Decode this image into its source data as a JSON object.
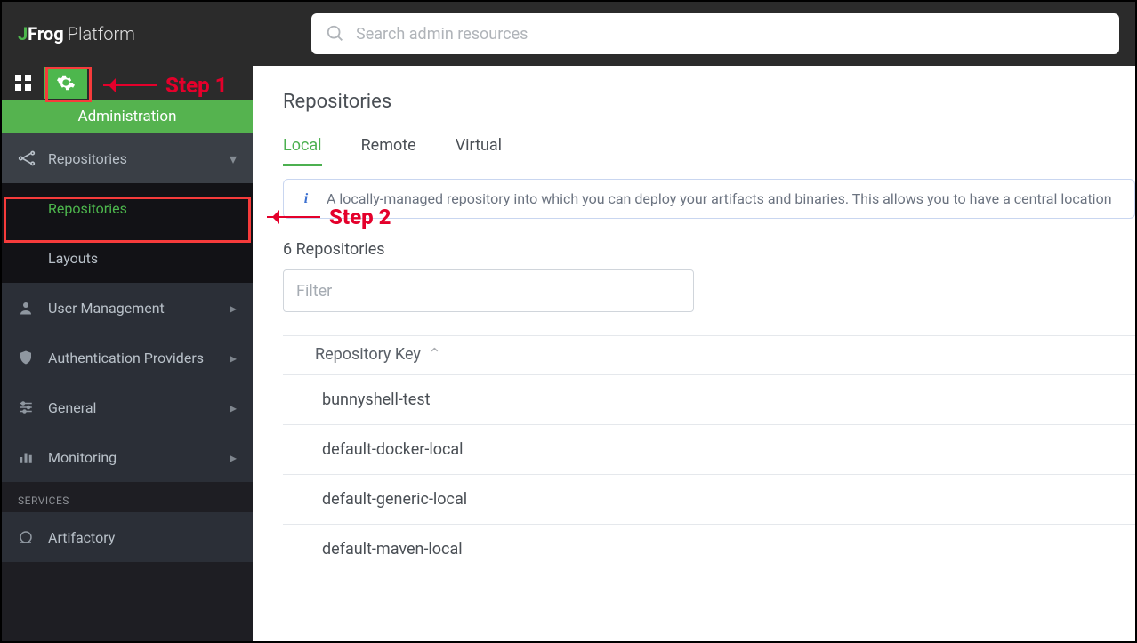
{
  "brand": {
    "j": "J",
    "frog": "Frog",
    "platform": "Platform"
  },
  "search": {
    "placeholder": "Search admin resources"
  },
  "sidebar": {
    "admin_label": "Administration",
    "items": [
      {
        "label": "Repositories",
        "icon": "distribute",
        "expanded": true,
        "children": [
          {
            "label": "Repositories",
            "active": true
          },
          {
            "label": "Layouts"
          }
        ]
      },
      {
        "label": "User Management",
        "icon": "user"
      },
      {
        "label": "Authentication Providers",
        "icon": "shield"
      },
      {
        "label": "General",
        "icon": "sliders"
      },
      {
        "label": "Monitoring",
        "icon": "bars"
      }
    ],
    "services_header": "SERVICES",
    "services": [
      {
        "label": "Artifactory",
        "icon": "circle"
      }
    ]
  },
  "main": {
    "title": "Repositories",
    "tabs": [
      {
        "label": "Local",
        "active": true
      },
      {
        "label": "Remote"
      },
      {
        "label": "Virtual"
      }
    ],
    "info": "A locally-managed repository into which you can deploy your artifacts and binaries. This allows you to have a central location",
    "count_label": "6 Repositories",
    "filter_placeholder": "Filter",
    "column_header": "Repository Key",
    "rows": [
      {
        "key": "bunnyshell-test"
      },
      {
        "key": "default-docker-local"
      },
      {
        "key": "default-generic-local"
      },
      {
        "key": "default-maven-local"
      }
    ]
  },
  "callouts": {
    "step1": "Step 1",
    "step2": "Step 2"
  }
}
